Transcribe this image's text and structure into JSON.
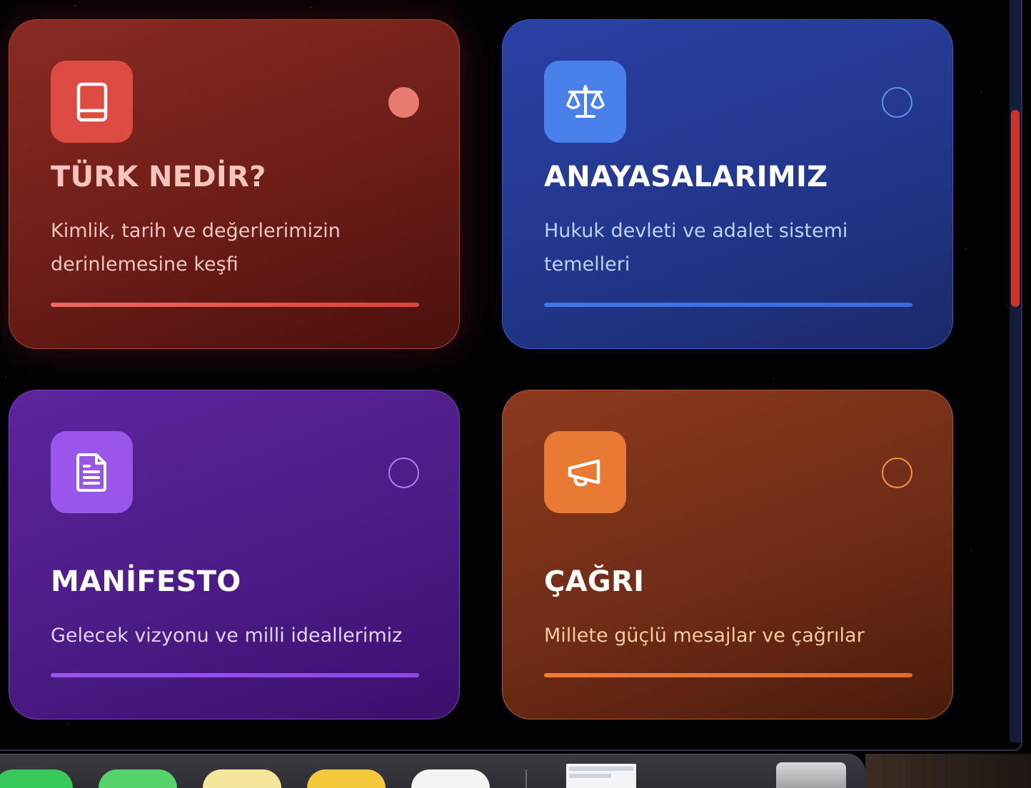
{
  "cards": [
    {
      "title": "TÜRK NEDİR?",
      "description": "Kimlik, tarih ve değerlerimizin derinlemesine keşfi",
      "icon": "book-icon",
      "accent": "#dd4b43",
      "selected": true
    },
    {
      "title": "ANAYASALARIMIZ",
      "description": "Hukuk devleti ve adalet sistemi temelleri",
      "icon": "scale-icon",
      "accent": "#4a80ea",
      "selected": false
    },
    {
      "title": "MANİFESTO",
      "description": "Gelecek vizyonu ve milli ideallerimiz",
      "icon": "document-icon",
      "accent": "#9a55ea",
      "selected": false
    },
    {
      "title": "ÇAĞRI",
      "description": "Millete güçlü mesajlar ve çağrılar",
      "icon": "megaphone-icon",
      "accent": "#e97a34",
      "selected": false
    }
  ],
  "dock": {
    "apps": [
      "phone-app-icon",
      "messages-app-icon",
      "notes-app-icon",
      "stickies-app-icon",
      "app-icon",
      "trash-icon"
    ]
  }
}
